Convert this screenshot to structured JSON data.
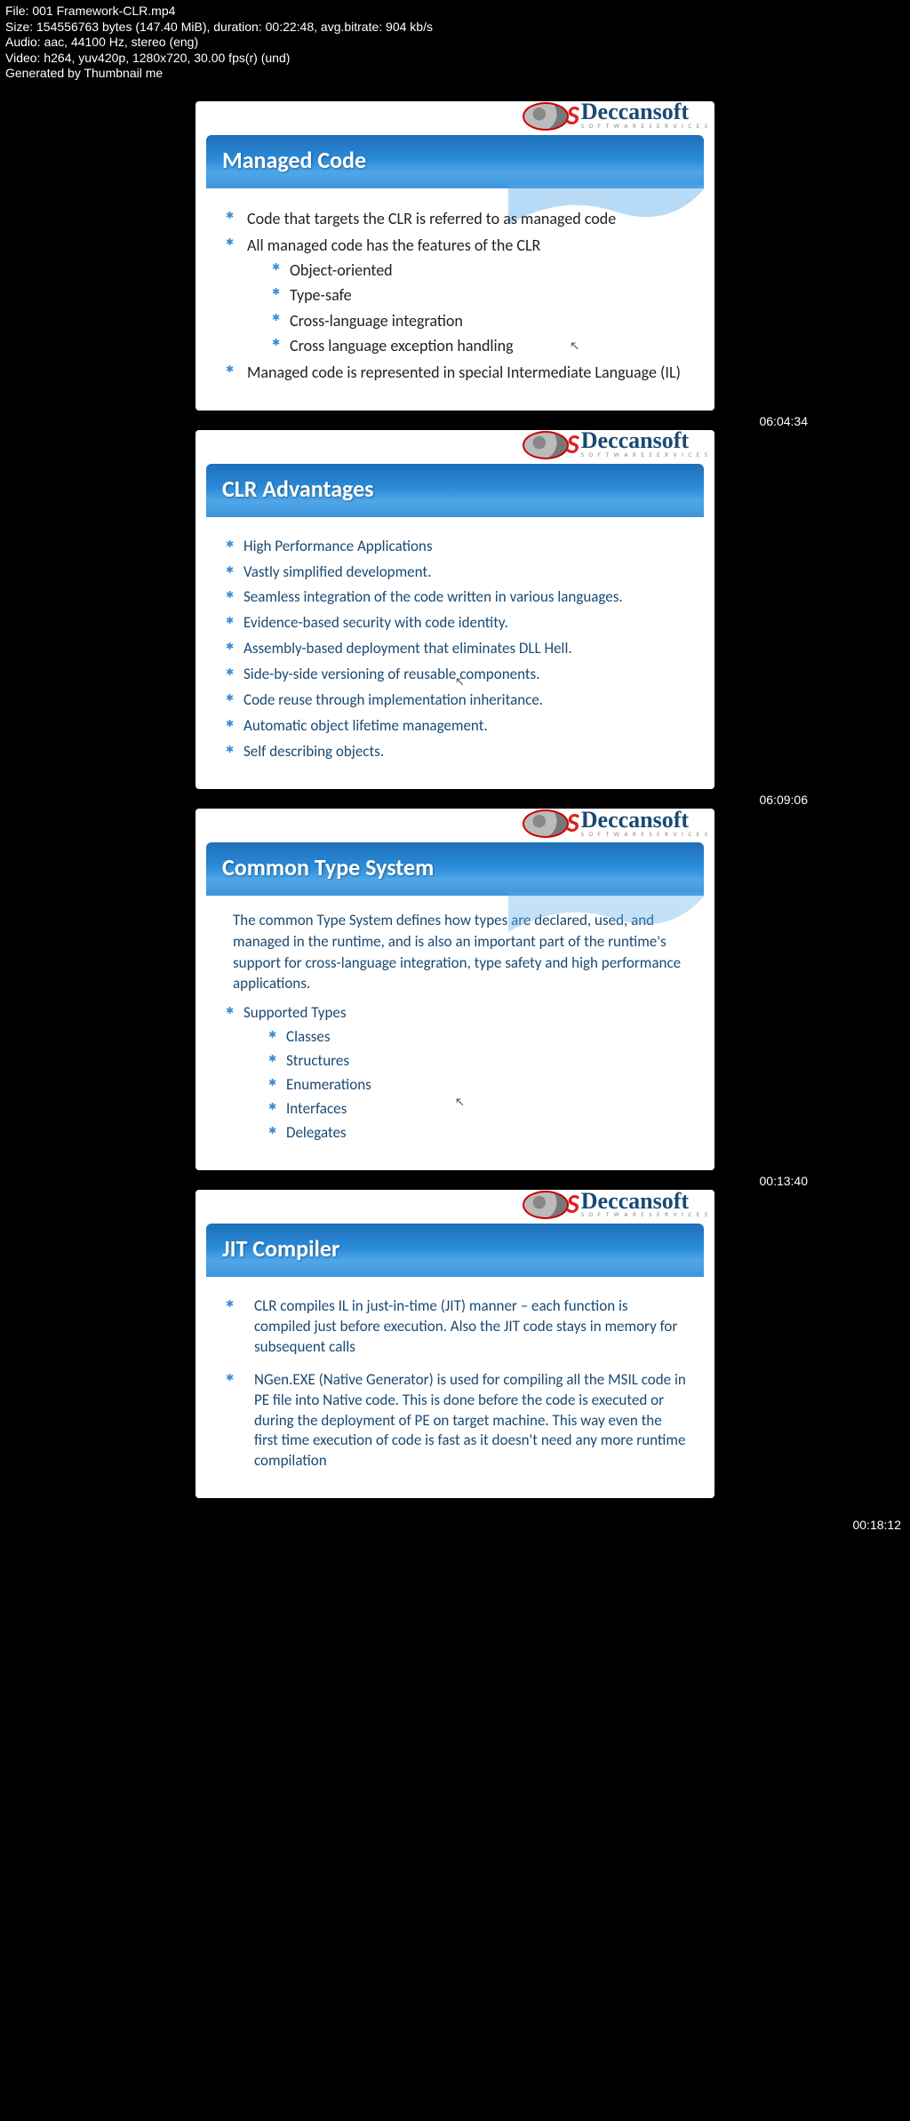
{
  "meta": {
    "file": "File: 001 Framework-CLR.mp4",
    "size": "Size: 154556763 bytes (147.40 MiB), duration: 00:22:48, avg.bitrate: 904 kb/s",
    "audio": "Audio: aac, 44100 Hz, stereo (eng)",
    "video": "Video: h264, yuv420p, 1280x720, 30.00 fps(r) (und)",
    "gen": "Generated by Thumbnail me"
  },
  "logo": {
    "name": "Deccansoft",
    "sub": "S O F T W A R E  S E R V I C E S"
  },
  "timestamps": {
    "t2": "06:04:34",
    "t3": "06:09:06",
    "t4": "00:13:40",
    "final": "00:18:12"
  },
  "slides": {
    "s1": {
      "title": "Managed Code",
      "li1": "Code that targets the CLR is referred to as managed code",
      "li2": "All managed code has the features of the CLR",
      "sub1": "Object-oriented",
      "sub2": "Type-safe",
      "sub3": "Cross-language integration",
      "sub4": "Cross language exception handling",
      "li3": "Managed code is represented in special Intermediate Language (IL)"
    },
    "s2": {
      "title": "CLR Advantages",
      "li1": "High Performance Applications",
      "li2": "Vastly simplified development.",
      "li3": "Seamless integration of the code written in various languages.",
      "li4": "Evidence-based security with code identity.",
      "li5": "Assembly-based deployment that eliminates DLL Hell.",
      "li6": "Side-by-side versioning of reusable components.",
      "li7": "Code reuse through implementation inheritance.",
      "li8": "Automatic object lifetime management.",
      "li9": "Self describing objects."
    },
    "s3": {
      "title": "Common Type System",
      "intro": "The common Type System defines how types are declared, used, and managed in the runtime, and is also an important part of the runtime's support for cross-language integration, type safety and high performance applications.",
      "li1": "Supported Types",
      "sub1": "Classes",
      "sub2": "Structures",
      "sub3": "Enumerations",
      "sub4": "Interfaces",
      "sub5": "Delegates"
    },
    "s4": {
      "title": "JIT Compiler",
      "li1": "CLR compiles IL in just-in-time (JIT) manner – each function is compiled just before execution. Also the JIT code stays in memory for subsequent calls",
      "li2": "NGen.EXE (Native Generator) is used for compiling all the MSIL code in PE file into Native code. This is done before the code is executed or during the deployment of PE on target machine. This way even the first time execution of code is fast as it doesn't need any more runtime compilation"
    }
  }
}
